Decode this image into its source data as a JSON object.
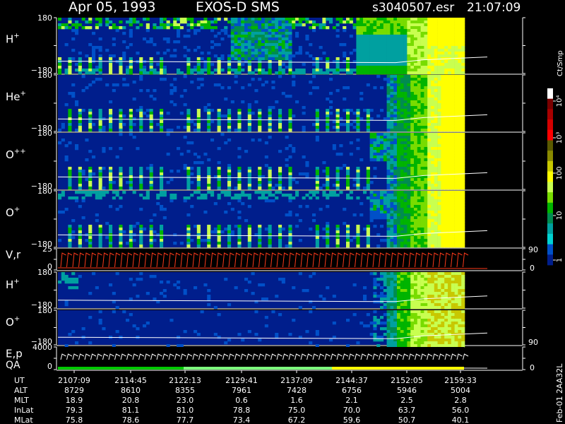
{
  "header": {
    "date": "Apr 05, 1993",
    "instrument": "EXOS-D SMS",
    "file": "s3040507.esr",
    "time": "21:07:09"
  },
  "chart_data": {
    "type": "heatmap",
    "colorbar": {
      "label": "Ct/Smp",
      "ticks": [
        "10⁴",
        "10³",
        "100",
        "10",
        "1"
      ],
      "colors": [
        "#ffffff",
        "#7a0000",
        "#a80000",
        "#d40000",
        "#ff0000",
        "#5a5a00",
        "#8a8a00",
        "#c8c800",
        "#ffff00",
        "#c8ff50",
        "#78dc00",
        "#00b400",
        "#008c50",
        "#00a0a0",
        "#00d2d2",
        "#0050c8",
        "#001e8c"
      ]
    },
    "panels": [
      {
        "label": "H",
        "sup": "+",
        "ymax": "180",
        "ymin": "−180",
        "pattern": "h1"
      },
      {
        "label": "He",
        "sup": "+",
        "ymax": "180",
        "ymin": "−180",
        "pattern": "he"
      },
      {
        "label": "O",
        "sup": "++",
        "ymax": "180",
        "ymin": "−180",
        "pattern": "o2"
      },
      {
        "label": "O",
        "sup": "+",
        "ymax": "180",
        "ymin": "−180",
        "pattern": "o1"
      },
      {
        "label": "V,r",
        "sup": "",
        "ymax": "25",
        "ymin": "0",
        "right_max": "90",
        "right_min": "0",
        "pattern": "vr"
      },
      {
        "label": "H",
        "sup": "+",
        "ymax": "180",
        "ymin": "−180",
        "pattern": "h2"
      },
      {
        "label": "O",
        "sup": "+",
        "ymax": "180",
        "ymin": "−180",
        "right_max": "90",
        "pattern": "o3"
      },
      {
        "label": "E,p",
        "sup": "",
        "label2": "QA",
        "ymax": "4000",
        "ymin": "0",
        "right_min": "0",
        "pattern": "ep"
      }
    ],
    "orbit_table": {
      "rows": [
        {
          "name": "UT",
          "values": [
            "2107:09",
            "2114:45",
            "2122:13",
            "2129:41",
            "2137:09",
            "2144:37",
            "2152:05",
            "2159:33"
          ]
        },
        {
          "name": "ALT",
          "values": [
            "8729",
            "8610",
            "8355",
            "7961",
            "7428",
            "6756",
            "5946",
            "5004"
          ]
        },
        {
          "name": "MLT",
          "values": [
            "18.9",
            "20.8",
            "23.0",
            "0.6",
            "1.6",
            "2.1",
            "2.5",
            "2.8"
          ]
        },
        {
          "name": "InLat",
          "values": [
            "79.3",
            "81.1",
            "81.0",
            "78.8",
            "75.0",
            "70.0",
            "63.7",
            "56.0"
          ]
        },
        {
          "name": "MLat",
          "values": [
            "75.8",
            "78.6",
            "77.7",
            "73.4",
            "67.2",
            "59.6",
            "50.7",
            "40.1"
          ]
        }
      ]
    },
    "footer": "Feb-01 2AA32L"
  }
}
